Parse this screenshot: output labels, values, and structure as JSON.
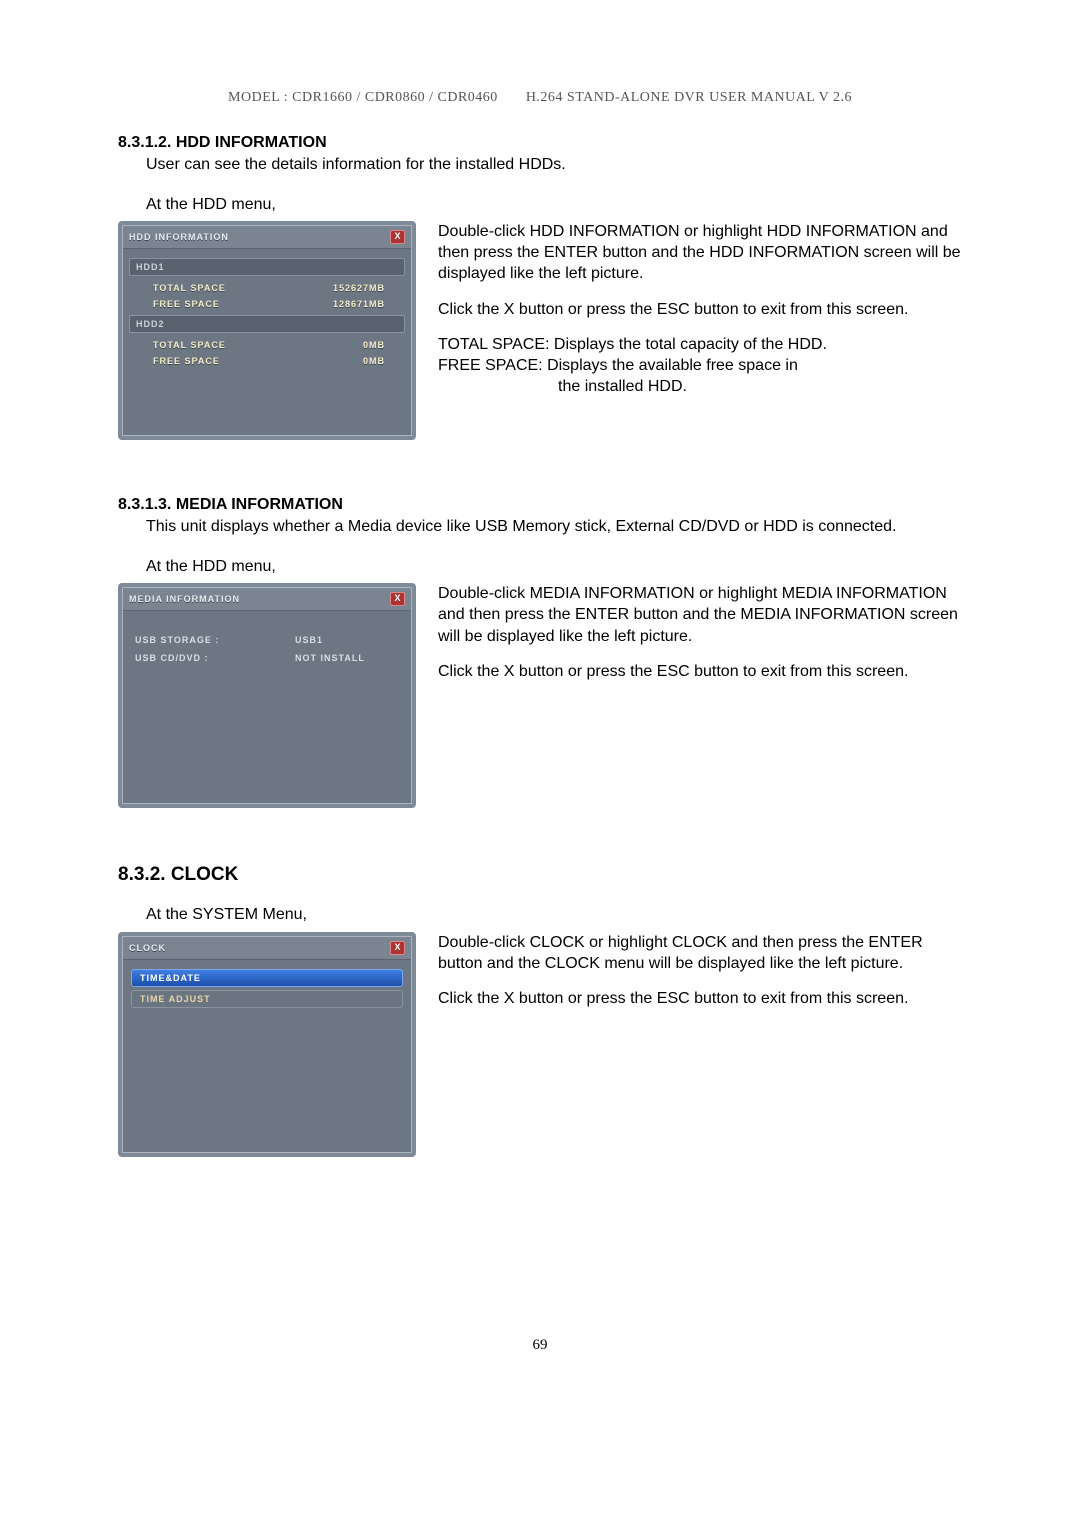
{
  "header": {
    "model": "MODEL : CDR1660 / CDR0860 / CDR0460",
    "doc": "H.264 STAND-ALONE DVR USER MANUAL V 2.6"
  },
  "sect1": {
    "title": "8.3.1.2.  HDD INFORMATION",
    "intro": "User can see the details information for the installed HDDs.",
    "at": "At the HDD menu,",
    "panel_title": "HDD INFORMATION",
    "close_x": "X",
    "hdd1": "HDD1",
    "hdd2": "HDD2",
    "total_label": "TOTAL SPACE",
    "free_label": "FREE SPACE",
    "hdd1_total": "152627MB",
    "hdd1_free": "128671MB",
    "hdd2_total": "0MB",
    "hdd2_free": "0MB",
    "p1": "Double-click HDD INFORMATION or highlight HDD INFORMATION and then press the ENTER button and the HDD INFORMATION screen will be displayed like the left picture.",
    "p2": "Click the X button or press the ESC button to exit from this screen.",
    "p3a": "TOTAL SPACE: Displays the total capacity of the HDD.",
    "p3b": "FREE SPACE: Displays the available free space in",
    "p3c": "the installed HDD."
  },
  "sect2": {
    "title": "8.3.1.3.  MEDIA INFORMATION",
    "intro": "This unit displays whether a Media device like USB Memory stick, External CD/DVD or HDD is connected.",
    "at": "At the HDD menu,",
    "panel_title": "MEDIA INFORMATION",
    "close_x": "X",
    "usb_storage_l": "USB STORAGE :",
    "usb_storage_v": "USB1",
    "usb_cd_l": "USB CD/DVD :",
    "usb_cd_v": "NOT INSTALL",
    "p1": "Double-click MEDIA INFORMATION or highlight MEDIA INFORMATION and then press the ENTER button and the MEDIA INFORMATION screen will be displayed like the left picture.",
    "p2": "Click the X button or press the ESC button to exit from this screen."
  },
  "sect3": {
    "title": "8.3.2.  CLOCK",
    "at": "At the SYSTEM Menu,",
    "panel_title": "CLOCK",
    "close_x": "X",
    "item1": "TIME&DATE",
    "item2": "TIME ADJUST",
    "p1": "Double-click CLOCK or highlight CLOCK and then press the ENTER button and the CLOCK menu will be displayed like the left picture.",
    "p2": "Click the X button or press the ESC button to exit from this screen."
  },
  "pagenum": "69"
}
